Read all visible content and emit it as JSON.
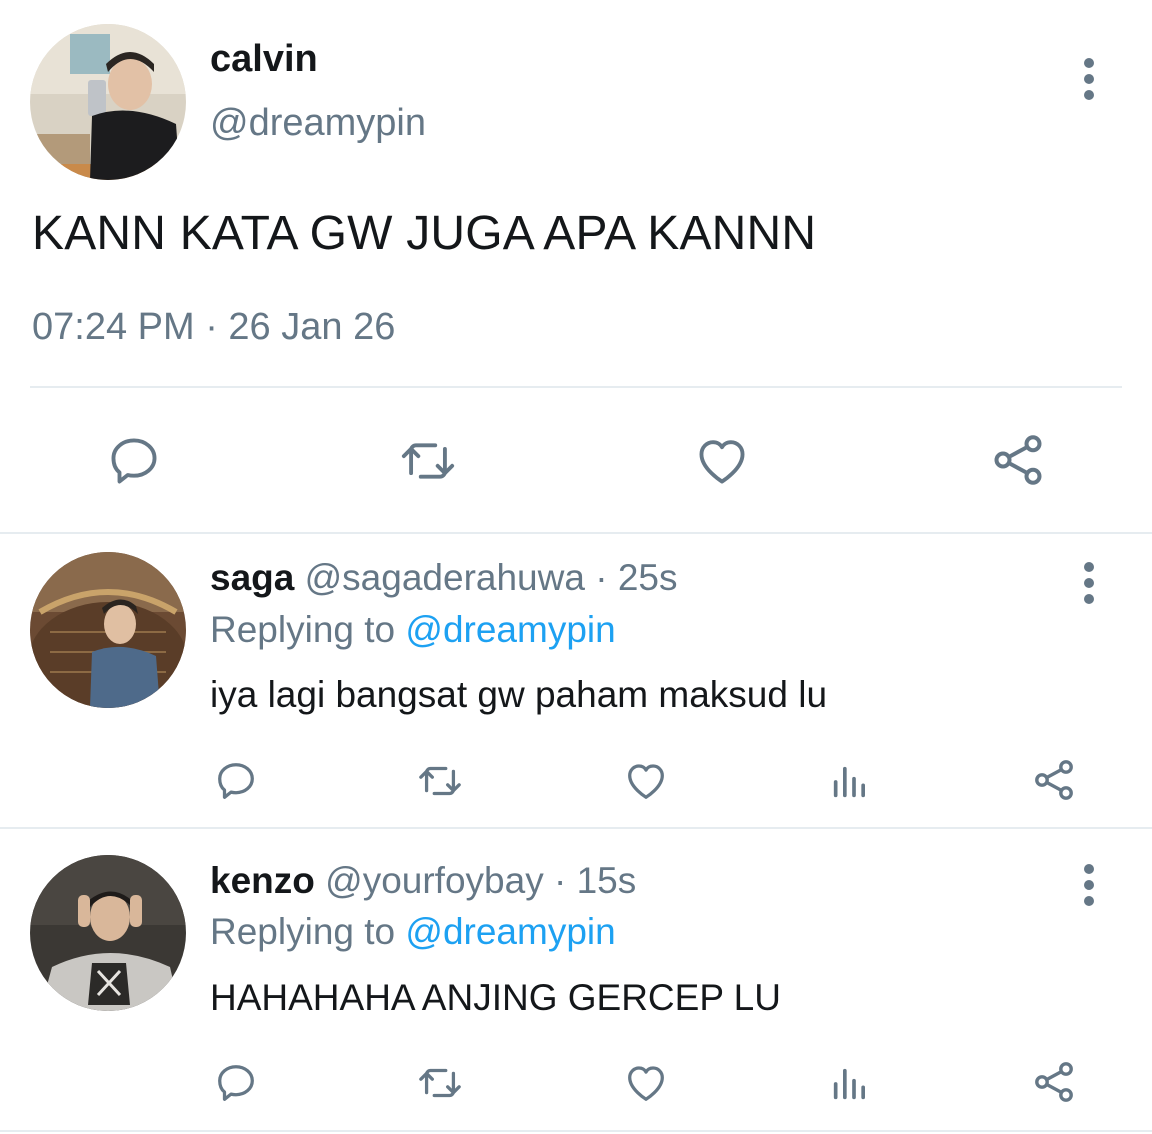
{
  "main_tweet": {
    "display_name": "calvin",
    "handle": "@dreamypin",
    "text": "KANN KATA GW JUGA APA KANNN",
    "timestamp": "07:24 PM · 26 Jan 26",
    "actions": [
      "comment-icon",
      "retweet-icon",
      "like-icon",
      "share-icon"
    ]
  },
  "replies": [
    {
      "display_name": "saga",
      "handle": "@sagaderahuwa",
      "separator": "·",
      "age": "25s",
      "replying_prefix": "Replying to",
      "replying_to": "@dreamypin",
      "text": "iya lagi bangsat gw paham maksud lu",
      "actions": [
        "comment-icon",
        "retweet-icon",
        "like-icon",
        "analytics-icon",
        "share-icon"
      ]
    },
    {
      "display_name": "kenzo",
      "handle": "@yourfoybay",
      "separator": "·",
      "age": "15s",
      "replying_prefix": "Replying to",
      "replying_to": "@dreamypin",
      "text": "HAHAHAHA ANJING GERCEP LU",
      "actions": [
        "comment-icon",
        "retweet-icon",
        "like-icon",
        "analytics-icon",
        "share-icon"
      ]
    }
  ],
  "colors": {
    "text": "#14171a",
    "secondary": "#657786",
    "link": "#1da1f2",
    "divider": "#e6ecf0"
  }
}
